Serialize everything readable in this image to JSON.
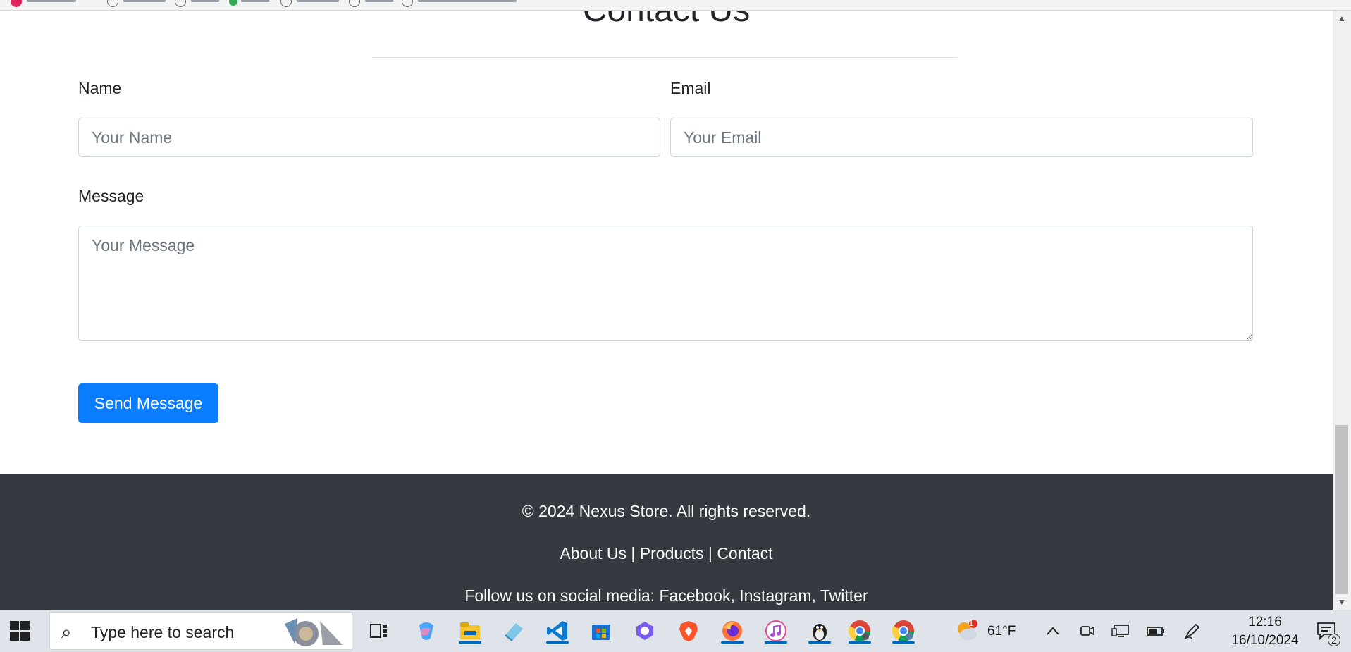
{
  "contact": {
    "heading": "Contact Us",
    "name_label": "Name",
    "name_placeholder": "Your Name",
    "email_label": "Email",
    "email_placeholder": "Your Email",
    "message_label": "Message",
    "message_placeholder": "Your Message",
    "send_label": "Send Message"
  },
  "footer": {
    "copyright": "© 2024 Nexus Store. All rights reserved.",
    "links": [
      "About Us",
      "Products",
      "Contact"
    ],
    "separator": " | ",
    "social_prefix": "Follow us on social media: ",
    "social": [
      "Facebook",
      "Instagram",
      "Twitter"
    ],
    "social_separator": ", "
  },
  "taskbar": {
    "search_placeholder": "Type here to search",
    "apps": [
      "task-view-icon",
      "copilot-icon",
      "file-explorer-icon",
      "notepad-icon",
      "vscode-icon",
      "microsoft-store-icon",
      "microsoft365-icon",
      "brave-icon",
      "firefox-icon",
      "itunes-icon",
      "app-penguin-icon",
      "chrome-icon",
      "chrome-profile-icon"
    ],
    "weather": {
      "badge": "1",
      "temp": "61°F"
    },
    "clock": {
      "time": "12:16",
      "date": "16/10/2024"
    },
    "notifications_count": "2"
  },
  "colors": {
    "primary": "#0a7cff",
    "footer_bg": "#343a40",
    "taskbar_bg": "#dfe3ea"
  }
}
